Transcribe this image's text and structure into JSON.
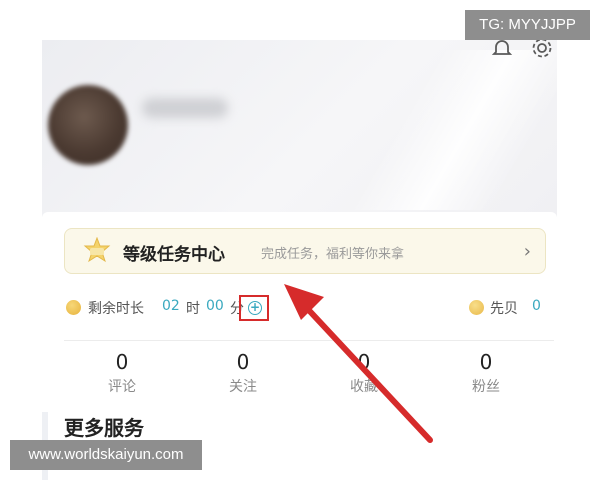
{
  "header": {
    "icons": [
      "bell-icon",
      "gear-icon"
    ]
  },
  "profile": {
    "avatar": "avatar-blurred",
    "username": ""
  },
  "task_center": {
    "title": "等级任务中心",
    "subtitle": "完成任务，福利等你来拿",
    "chevron": "›"
  },
  "stats": {
    "remaining_label": "剩余时长",
    "hours": "02",
    "hour_unit": "时",
    "minutes": "00",
    "minute_unit": "分",
    "add_symbol": "+",
    "shell_label": "先贝",
    "shell_value": "0"
  },
  "counters": [
    {
      "value": "0",
      "label": "评论"
    },
    {
      "value": "0",
      "label": "关注"
    },
    {
      "value": "0",
      "label": "收藏"
    },
    {
      "value": "0",
      "label": "粉丝"
    }
  ],
  "more_services": {
    "title": "更多服务"
  },
  "watermarks": {
    "top_right": "TG: MYYJJPP",
    "bottom_left": "www.worldskaiyun.com"
  },
  "colors": {
    "accent_teal": "#3aa9bf",
    "highlight_red": "#d62b2b",
    "banner_bg": "#fbf8ea",
    "coin_gold": "#e7b33d"
  }
}
